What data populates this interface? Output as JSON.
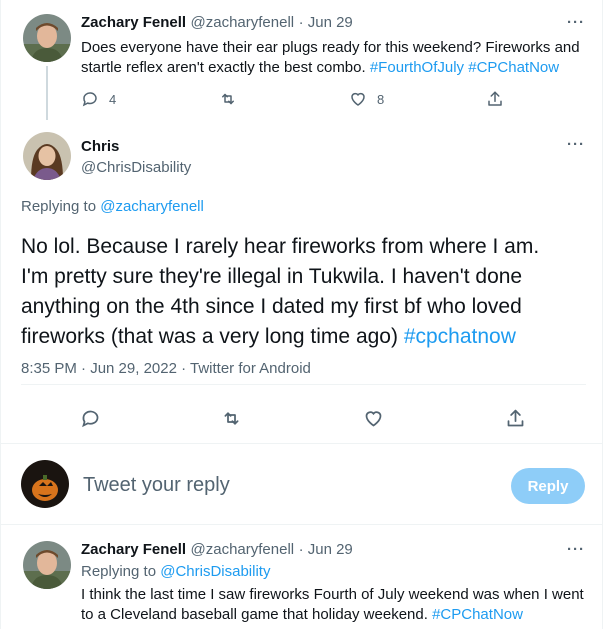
{
  "tweet1": {
    "name": "Zachary Fenell",
    "handle": "@zacharyfenell",
    "time": "· Jun 29",
    "more": "···",
    "text_line1": "Does everyone have their ear plugs ready for this weekend? Fireworks and",
    "text_line2_a": "startle reflex aren't exactly the best combo. ",
    "hashtag1": "#FourthOfJuly",
    "hashtag2": "#CPChatNow",
    "replies": "4",
    "likes": "8"
  },
  "tweet2": {
    "name": "Chris",
    "handle": "@ChrisDisability",
    "more": "···",
    "replying_label": "Replying to ",
    "replying_to": "@zacharyfenell",
    "line1": "No lol. Because I rarely hear fireworks from where I am.",
    "line2": "I'm pretty sure they're illegal in Tukwila. I haven't done",
    "line3": "anything on the 4th since I dated my first bf who loved",
    "line4": "fireworks (that was a very long time ago) ",
    "hashtag": "#cpchatnow",
    "timestamp": "8:35 PM · Jun 29, 2022 · Twitter for Android"
  },
  "reply_box": {
    "placeholder": "Tweet your reply",
    "button": "Reply"
  },
  "tweet3": {
    "name": "Zachary Fenell",
    "handle": "@zacharyfenell",
    "time": "· Jun 29",
    "more": "···",
    "replying_label": "Replying to ",
    "replying_to": "@ChrisDisability",
    "line1": "I think the last time I saw fireworks Fourth of July weekend was when I went",
    "line2": "to a Cleveland baseball game that holiday weekend. ",
    "hashtag": "#CPChatNow"
  },
  "colors": {
    "accent": "#1d9bf0",
    "muted": "#536471",
    "reply_button_disabled": "#8ecdf8"
  }
}
